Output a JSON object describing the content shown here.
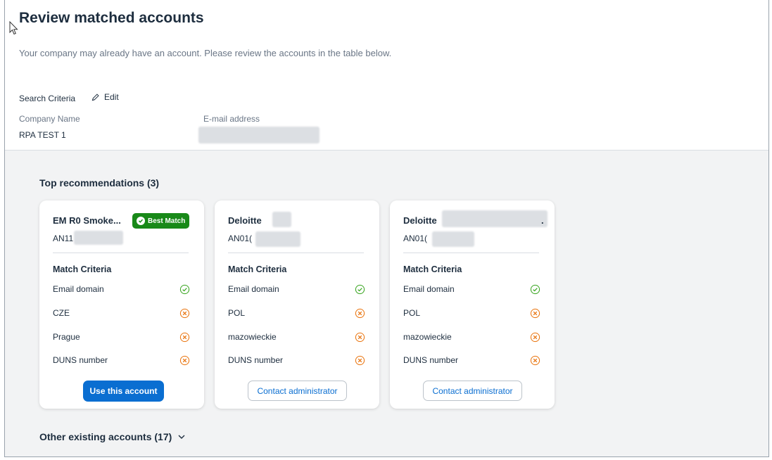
{
  "page": {
    "title": "Review matched accounts",
    "subtitle": "Your company may already have an account. Please review the accounts in the table below."
  },
  "search": {
    "label": "Search Criteria",
    "edit_label": "Edit",
    "company_label": "Company Name",
    "company_value": "RPA TEST 1",
    "email_label": "E-mail address"
  },
  "recommendations": {
    "title": "Top recommendations (3)",
    "match_criteria_label": "Match Criteria",
    "cards": [
      {
        "name": "EM R0 Smoke...",
        "id": "AN11",
        "badge": "Best Match",
        "criteria": [
          {
            "label": "Email domain",
            "status": "match"
          },
          {
            "label": "CZE",
            "status": "mismatch"
          },
          {
            "label": "Prague",
            "status": "mismatch"
          },
          {
            "label": "DUNS number",
            "status": "mismatch"
          }
        ],
        "action": "Use this account"
      },
      {
        "name": "Deloitte",
        "id": "AN01(",
        "criteria": [
          {
            "label": "Email domain",
            "status": "match"
          },
          {
            "label": "POL",
            "status": "mismatch"
          },
          {
            "label": "mazowieckie",
            "status": "mismatch"
          },
          {
            "label": "DUNS number",
            "status": "mismatch"
          }
        ],
        "action": "Contact administrator"
      },
      {
        "name": "Deloitte",
        "name_suffix": ".",
        "id": "AN01(",
        "criteria": [
          {
            "label": "Email domain",
            "status": "match"
          },
          {
            "label": "POL",
            "status": "mismatch"
          },
          {
            "label": "mazowieckie",
            "status": "mismatch"
          },
          {
            "label": "DUNS number",
            "status": "mismatch"
          }
        ],
        "action": "Contact administrator"
      }
    ]
  },
  "other_accounts": {
    "label": "Other existing accounts (17)"
  },
  "colors": {
    "primary": "#0a6ed1",
    "success": "#188918",
    "error": "#e9730c",
    "check": "#36a41d"
  }
}
